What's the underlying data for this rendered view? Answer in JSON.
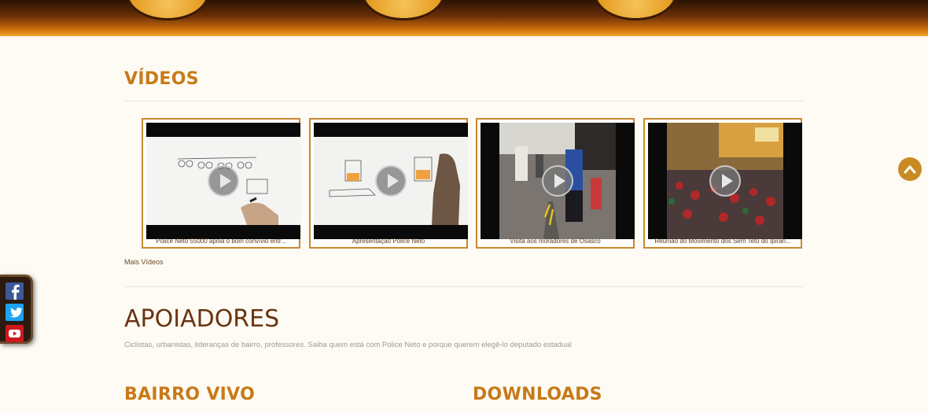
{
  "videos_section": {
    "title": "VÍDEOS",
    "more_link": "Mais Vídeos",
    "items": [
      {
        "caption": "Police Neto 55000 apoia o bom convívio entr...",
        "icon": "play-icon"
      },
      {
        "caption": "Apresentação Police Neto",
        "icon": "play-icon"
      },
      {
        "caption": "Visita aos moradores de Osasco",
        "icon": "play-icon"
      },
      {
        "caption": "Reunião do Movimento dos Sem Teto do Ipiran...",
        "icon": "play-icon"
      }
    ]
  },
  "supporters_section": {
    "title": "APOIADORES",
    "description": "Ciclistas, urbanistas, lideranças de bairro, professores. Saiba quem está com Police Neto e porque querem elegê-lo deputado estadual"
  },
  "bairro_section": {
    "title": "BAIRRO VIVO"
  },
  "downloads_section": {
    "title": "DOWNLOADS"
  },
  "social": {
    "items": [
      {
        "icon": "facebook-icon",
        "color": "#3b5998"
      },
      {
        "icon": "twitter-icon",
        "color": "#1da1f2"
      },
      {
        "icon": "youtube-icon",
        "color": "#cc181e"
      }
    ]
  },
  "colors": {
    "accent": "#c87a18",
    "heading_dark": "#6a3410",
    "background": "#fdfbf3"
  }
}
